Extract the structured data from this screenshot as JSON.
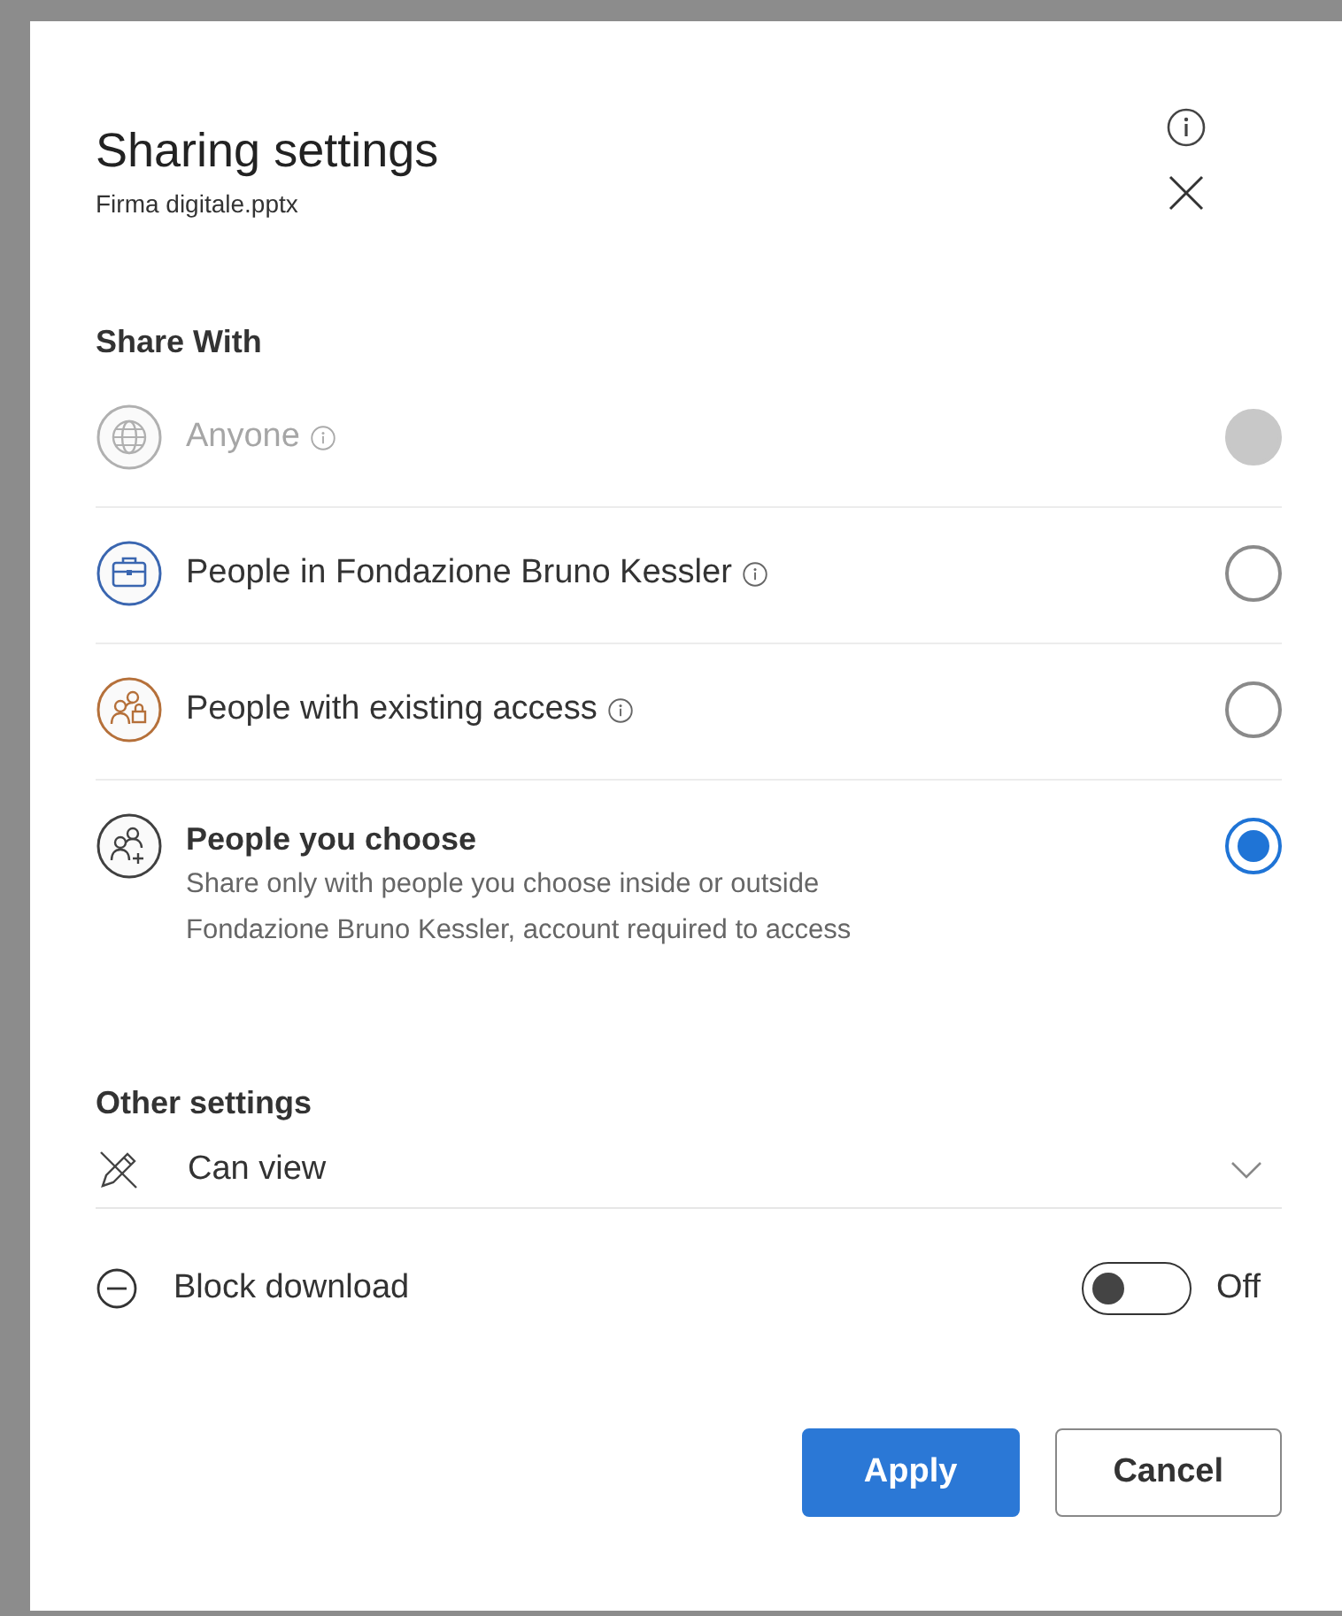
{
  "dialog": {
    "title": "Sharing settings",
    "subtitle": "Firma digitale.pptx"
  },
  "share_with": {
    "heading": "Share With",
    "options": [
      {
        "kind": "globe",
        "color": "#b0b0b0",
        "label": "Anyone",
        "info": true,
        "selected": false,
        "disabled": true
      },
      {
        "kind": "briefcase",
        "color": "#3a66b0",
        "label": "People in Fondazione Bruno Kessler",
        "info": true,
        "selected": false,
        "disabled": false
      },
      {
        "kind": "people-lock",
        "color": "#b5703a",
        "label": "People with existing access",
        "info": true,
        "selected": false,
        "disabled": false
      },
      {
        "kind": "people-add",
        "color": "#404040",
        "label": "People you choose",
        "info": false,
        "description": "Share only with people you choose inside or outside Fondazione Bruno Kessler, account required to access",
        "selected": true,
        "disabled": false
      }
    ]
  },
  "other_settings": {
    "heading": "Other settings",
    "permission": "Can view",
    "block_download": {
      "label": "Block download",
      "on": false,
      "state_text": "Off"
    }
  },
  "buttons": [
    {
      "kind": "primary",
      "label": "Apply"
    },
    {
      "kind": "secondary",
      "label": "Cancel"
    }
  ]
}
